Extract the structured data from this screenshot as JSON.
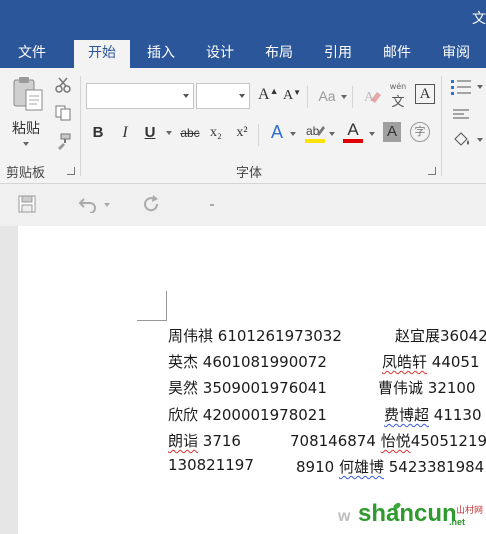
{
  "window": {
    "title_fragment": "文"
  },
  "tabs": [
    {
      "id": "file",
      "label": "文件"
    },
    {
      "id": "home",
      "label": "开始"
    },
    {
      "id": "insert",
      "label": "插入"
    },
    {
      "id": "design",
      "label": "设计"
    },
    {
      "id": "layout",
      "label": "布局"
    },
    {
      "id": "references",
      "label": "引用"
    },
    {
      "id": "mailings",
      "label": "邮件"
    },
    {
      "id": "review",
      "label": "审阅"
    }
  ],
  "ribbon": {
    "clipboard": {
      "paste_label": "粘贴",
      "group_label": "剪贴板"
    },
    "font": {
      "group_label": "字体",
      "font_name_value": "",
      "font_size_value": "",
      "bold": "B",
      "italic": "I",
      "underline": "U",
      "strikethrough": "abc",
      "subscript": "x₂",
      "superscript": "x²",
      "grow": "A",
      "shrink": "A",
      "case": "Aa",
      "text_effect": "A",
      "font_color": "A",
      "shading": "A",
      "char_border": "A",
      "phonetic": "文",
      "phonetic_top": "wén",
      "enclose": "字"
    }
  },
  "document": {
    "lines": [
      {
        "name": "周伟祺",
        "number": "6101261973032",
        "name2": "赵宜展",
        "number2": "36042"
      },
      {
        "name": "英杰",
        "number": "4601081990072",
        "name2": "凤皓轩",
        "number2": "44051"
      },
      {
        "name": "昊然",
        "number": "3509001976041",
        "name2": "曹伟诚",
        "number2": "32100"
      },
      {
        "name": "欣欣",
        "number": "4200001978021",
        "name2": "费博超",
        "number2": "41130"
      },
      {
        "name": "朗诣",
        "number": "3716",
        "middle": "708146874",
        "name2": "怡悦",
        "number2": "45051219"
      },
      {
        "name": "",
        "number": "130821197",
        "middle": "8910",
        "name2": "何雄博",
        "number2": "5423381984"
      }
    ]
  },
  "watermark": {
    "text": "shancun",
    "suffix": ".net",
    "tag": "山村网",
    "prefix": "w"
  },
  "colors": {
    "brand": "#2b579a",
    "ribbon": "#f3f3f3",
    "highlight": "#ffe300",
    "font_color": "#e00000"
  }
}
